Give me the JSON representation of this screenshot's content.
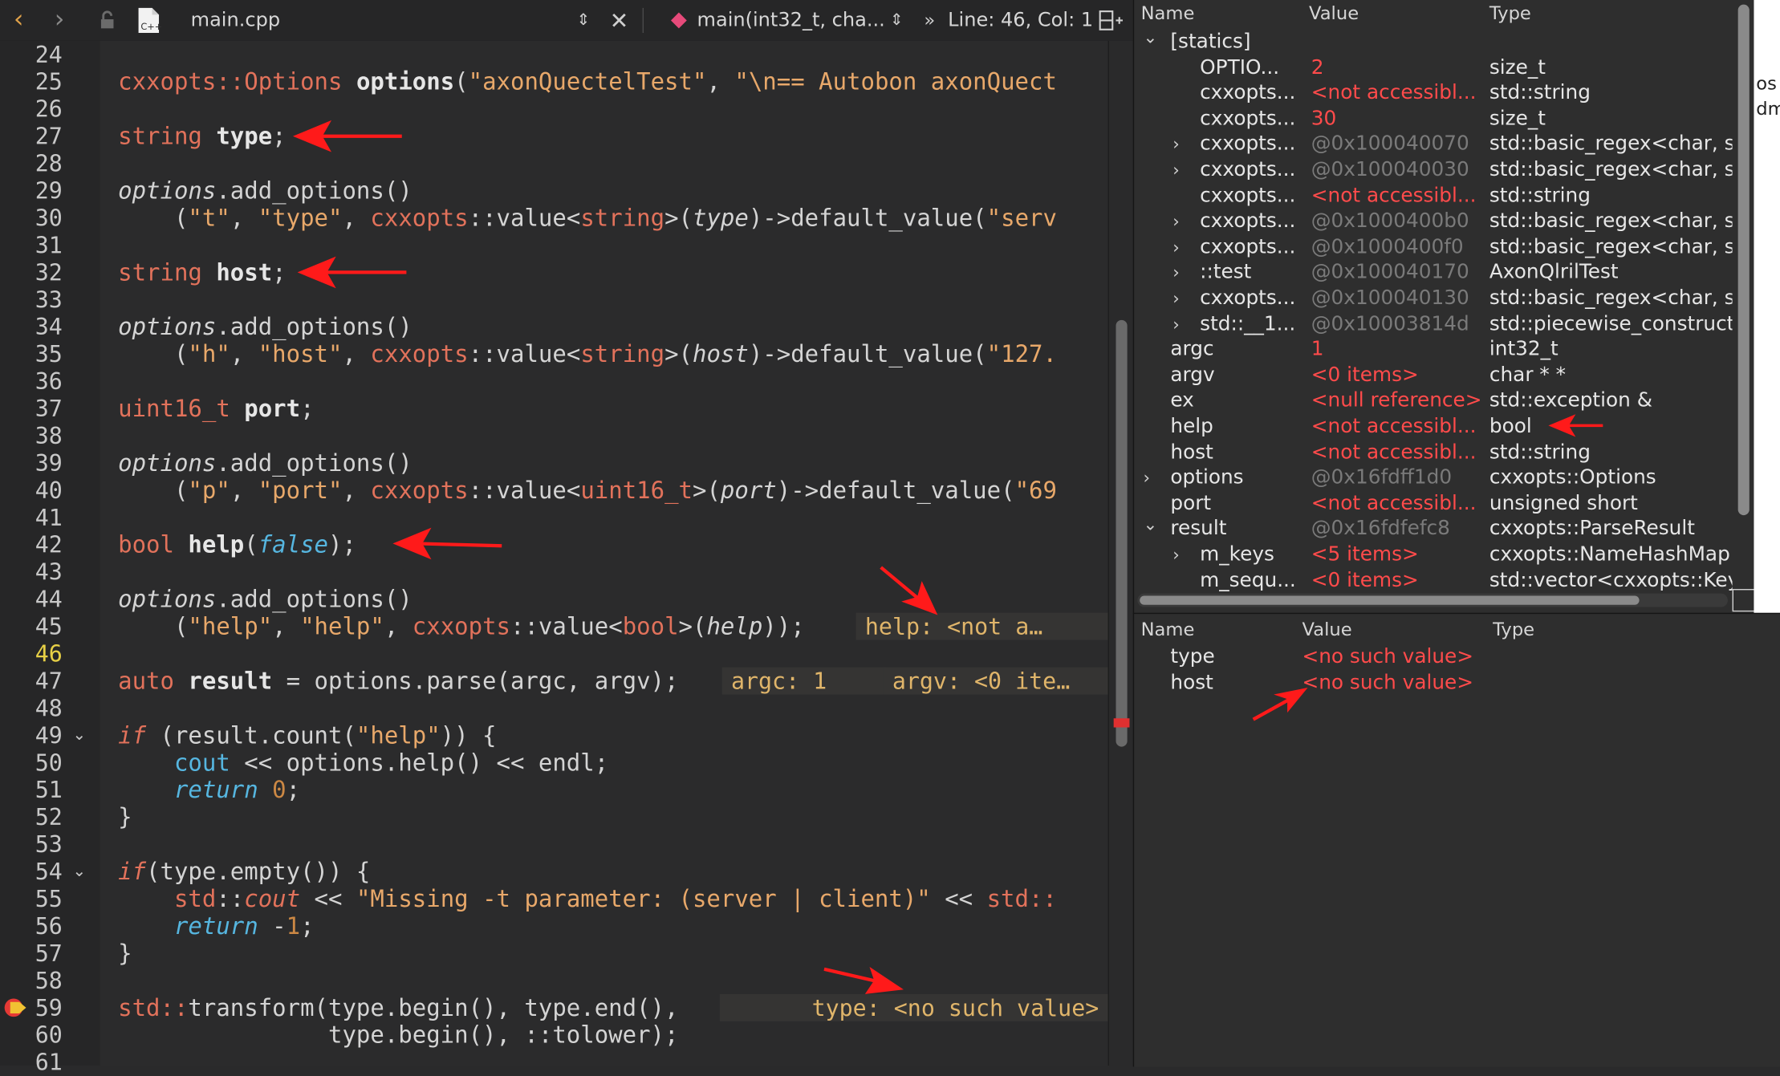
{
  "toolbar": {
    "file_name": "main.cpp",
    "function_name": "main(int32_t, cha...",
    "position": "Line: 46, Col: 1"
  },
  "editor": {
    "line_numbers": [
      "24",
      "25",
      "26",
      "27",
      "28",
      "29",
      "30",
      "31",
      "32",
      "33",
      "34",
      "35",
      "36",
      "37",
      "38",
      "39",
      "40",
      "41",
      "42",
      "43",
      "44",
      "45",
      "46",
      "47",
      "48",
      "49",
      "50",
      "51",
      "52",
      "53",
      "54",
      "55",
      "56",
      "57",
      "58",
      "59",
      "60",
      "61"
    ],
    "current_line": "46",
    "breakpoint_line": "59",
    "inline_values": {
      "help": "help: <not a…",
      "argc": "argc: 1",
      "argv": "argv: <0 ite…",
      "type": "type: <no such value>"
    }
  },
  "variables": {
    "headers": {
      "name": "Name",
      "value": "Value",
      "type": "Type"
    },
    "rows": [
      {
        "name": "[statics]",
        "value": "",
        "type": ""
      },
      {
        "name": "OPTIO...",
        "value": "2",
        "type": "size_t"
      },
      {
        "name": "cxxopts...",
        "value": "<not accessibl...",
        "type": "std::string"
      },
      {
        "name": "cxxopts...",
        "value": "30",
        "type": "size_t"
      },
      {
        "name": "cxxopts...",
        "value": "@0x100040070",
        "type": "std::basic_regex<char, std"
      },
      {
        "name": "cxxopts...",
        "value": "@0x100040030",
        "type": "std::basic_regex<char, std"
      },
      {
        "name": "cxxopts...",
        "value": "<not accessibl...",
        "type": "std::string"
      },
      {
        "name": "cxxopts...",
        "value": "@0x1000400b0",
        "type": "std::basic_regex<char, std"
      },
      {
        "name": "cxxopts...",
        "value": "@0x1000400f0",
        "type": "std::basic_regex<char, std"
      },
      {
        "name": "::test",
        "value": "@0x100040170",
        "type": "AxonQlrilTest"
      },
      {
        "name": "cxxopts...",
        "value": "@0x100040130",
        "type": "std::basic_regex<char, std"
      },
      {
        "name": "std::__1...",
        "value": "@0x10003814d",
        "type": "std::piecewise_construct_"
      },
      {
        "name": "argc",
        "value": "1",
        "type": "int32_t"
      },
      {
        "name": "argv",
        "value": "<0 items>",
        "type": "char * *"
      },
      {
        "name": "ex",
        "value": "<null reference>",
        "type": "std::exception &"
      },
      {
        "name": "help",
        "value": "<not accessibl...",
        "type": "bool"
      },
      {
        "name": "host",
        "value": "<not accessibl...",
        "type": "std::string"
      },
      {
        "name": "options",
        "value": "@0x16fdff1d0",
        "type": "cxxopts::Options"
      },
      {
        "name": "port",
        "value": "<not accessibl...",
        "type": "unsigned short"
      },
      {
        "name": "result",
        "value": "@0x16fdfefc8",
        "type": "cxxopts::ParseResult"
      },
      {
        "name": "m_keys",
        "value": "<5 items>",
        "type": "cxxopts::NameHashMap"
      },
      {
        "name": "m_sequ...",
        "value": "<0 items>",
        "type": "std::vector<cxxopts::KeyV"
      }
    ]
  },
  "watch": {
    "headers": {
      "name": "Name",
      "value": "Value",
      "type": "Type"
    },
    "rows": [
      {
        "name": "type",
        "value": "<no such value>",
        "type": ""
      },
      {
        "name": "host",
        "value": "<no such value>",
        "type": ""
      }
    ]
  },
  "edge_text": {
    "a": "os",
    "b": "dm"
  },
  "colors": {
    "annotation_arrow": "#ff1a1a",
    "value_red": "#ff4b4b",
    "address_gray": "#7a7a7a",
    "current_line": "#e7d046"
  }
}
